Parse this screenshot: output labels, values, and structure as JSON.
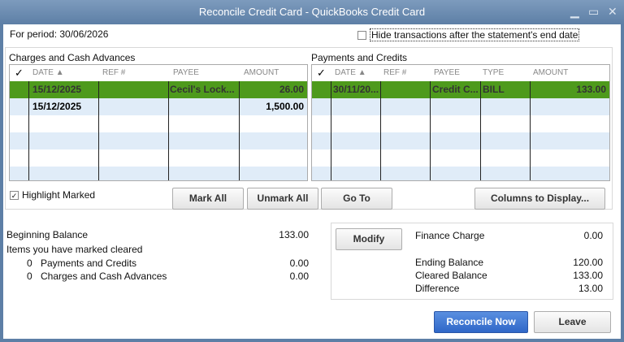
{
  "window": {
    "title": "Reconcile Credit Card - QuickBooks Credit Card"
  },
  "period": "For period: 30/06/2026",
  "hide_label": "Hide transactions after the statement's end date",
  "charges": {
    "title": "Charges and Cash Advances",
    "headers": [
      "DATE",
      "REF #",
      "PAYEE",
      "AMOUNT"
    ],
    "rows": [
      {
        "date": "15/12/2025",
        "ref": "",
        "payee": "Cecil's Lock...",
        "amount": "26.00",
        "selected": true
      },
      {
        "date": "15/12/2025",
        "ref": "",
        "payee": "",
        "amount": "1,500.00",
        "selected": false
      }
    ]
  },
  "payments": {
    "title": "Payments and Credits",
    "headers": [
      "DATE",
      "REF #",
      "PAYEE",
      "TYPE",
      "AMOUNT"
    ],
    "rows": [
      {
        "date": "30/11/20...",
        "ref": "",
        "payee": "Credit C...",
        "type": "BILL",
        "amount": "133.00",
        "selected": true
      }
    ]
  },
  "check_header": "✓",
  "highlight_label": "Highlight Marked",
  "buttons": {
    "mark_all": "Mark All",
    "unmark_all": "Unmark All",
    "go_to": "Go To",
    "columns": "Columns to Display...",
    "modify": "Modify",
    "reconcile": "Reconcile Now",
    "leave": "Leave"
  },
  "summary": {
    "beginning_label": "Beginning Balance",
    "beginning": "133.00",
    "marked_label": "Items you have marked cleared",
    "payments_count": "0",
    "payments_label": "Payments and Credits",
    "payments_amt": "0.00",
    "charges_count": "0",
    "charges_label": "Charges and Cash Advances",
    "charges_amt": "0.00"
  },
  "right": {
    "finance_label": "Finance Charge",
    "finance": "0.00",
    "ending_label": "Ending Balance",
    "ending": "120.00",
    "cleared_label": "Cleared Balance",
    "cleared": "133.00",
    "diff_label": "Difference",
    "diff": "13.00"
  }
}
